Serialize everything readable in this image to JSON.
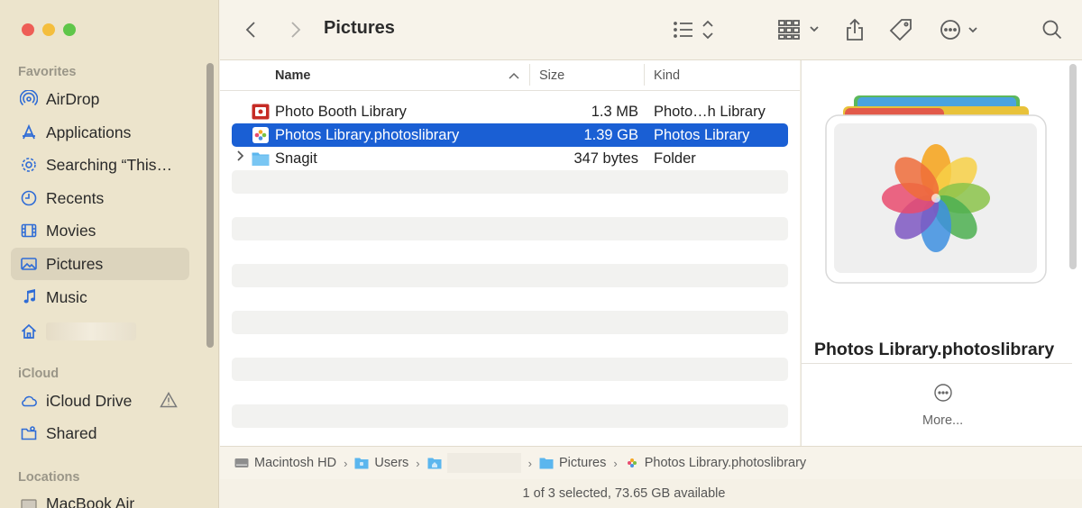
{
  "window": {
    "title": "Pictures"
  },
  "sidebar": {
    "sections": [
      {
        "label": "Favorites"
      },
      {
        "label": "iCloud"
      },
      {
        "label": "Locations"
      }
    ],
    "favorites": [
      {
        "label": "AirDrop",
        "icon": "airdrop-icon"
      },
      {
        "label": "Applications",
        "icon": "applications-icon"
      },
      {
        "label": "Searching “This…",
        "icon": "gear-icon"
      },
      {
        "label": "Recents",
        "icon": "clock-icon"
      },
      {
        "label": "Movies",
        "icon": "film-icon"
      },
      {
        "label": "Pictures",
        "icon": "photo-icon",
        "active": true
      },
      {
        "label": "Music",
        "icon": "music-note-icon"
      },
      {
        "label": "",
        "icon": "home-icon"
      }
    ],
    "icloud": [
      {
        "label": "iCloud Drive",
        "icon": "cloud-icon"
      },
      {
        "label": "Shared",
        "icon": "shared-folder-icon"
      }
    ],
    "locations": [
      {
        "label": "MacBook Air",
        "icon": "laptop-icon"
      }
    ]
  },
  "columns": {
    "name": "Name",
    "size": "Size",
    "kind": "Kind"
  },
  "files": [
    {
      "name": "Photo Booth Library",
      "size": "1.3 MB",
      "kind": "Photo…h Library",
      "icon": "photo-booth-icon",
      "selected": false
    },
    {
      "name": "Photos Library.photoslibrary",
      "size": "1.39 GB",
      "kind": "Photos Library",
      "icon": "photos-icon",
      "selected": true
    },
    {
      "name": "Snagit",
      "size": "347 bytes",
      "kind": "Folder",
      "icon": "folder-icon",
      "selected": false
    }
  ],
  "preview": {
    "name": "Photos Library.photoslibrary",
    "more_label": "More..."
  },
  "pathbar": [
    {
      "label": "Macintosh HD",
      "icon": "disk-icon"
    },
    {
      "label": "Users",
      "icon": "folder-icon"
    },
    {
      "label": "",
      "icon": "home-folder-icon"
    },
    {
      "label": "Pictures",
      "icon": "folder-icon"
    },
    {
      "label": "Photos Library.photoslibrary",
      "icon": "photos-icon"
    }
  ],
  "status": {
    "text": "1 of 3 selected, 73.65 GB available"
  },
  "colors": {
    "accent": "#1a5fd4",
    "sidebar_bg": "#ece4cc"
  }
}
